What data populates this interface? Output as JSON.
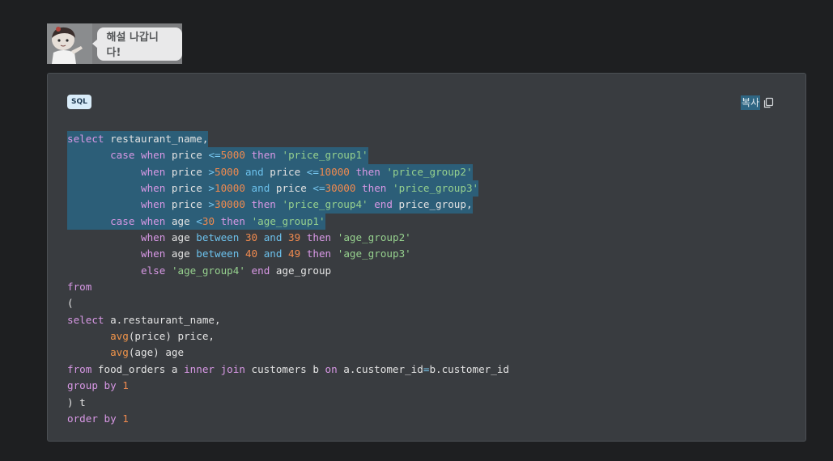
{
  "banner": {
    "bubble_text": "해설 나갑니다!"
  },
  "code_block": {
    "language": "SQL",
    "copy_label": "복사",
    "lines": [
      {
        "hl": true,
        "tokens": [
          [
            "k",
            "select"
          ],
          [
            "p",
            " restaurant_name,"
          ]
        ]
      },
      {
        "hl": true,
        "tokens": [
          [
            "p",
            "       "
          ],
          [
            "k",
            "case"
          ],
          [
            "p",
            " "
          ],
          [
            "k",
            "when"
          ],
          [
            "p",
            " price "
          ],
          [
            "o",
            "<="
          ],
          [
            "n",
            "5000"
          ],
          [
            "p",
            " "
          ],
          [
            "k",
            "then"
          ],
          [
            "p",
            " "
          ],
          [
            "s",
            "'price_group1'"
          ]
        ]
      },
      {
        "hl": true,
        "tokens": [
          [
            "p",
            "            "
          ],
          [
            "k",
            "when"
          ],
          [
            "p",
            " price "
          ],
          [
            "o",
            ">"
          ],
          [
            "n",
            "5000"
          ],
          [
            "p",
            " "
          ],
          [
            "kb",
            "and"
          ],
          [
            "p",
            " price "
          ],
          [
            "o",
            "<="
          ],
          [
            "n",
            "10000"
          ],
          [
            "p",
            " "
          ],
          [
            "k",
            "then"
          ],
          [
            "p",
            " "
          ],
          [
            "s",
            "'price_group2'"
          ]
        ]
      },
      {
        "hl": true,
        "tokens": [
          [
            "p",
            "            "
          ],
          [
            "k",
            "when"
          ],
          [
            "p",
            " price "
          ],
          [
            "o",
            ">"
          ],
          [
            "n",
            "10000"
          ],
          [
            "p",
            " "
          ],
          [
            "kb",
            "and"
          ],
          [
            "p",
            " price "
          ],
          [
            "o",
            "<="
          ],
          [
            "n",
            "30000"
          ],
          [
            "p",
            " "
          ],
          [
            "k",
            "then"
          ],
          [
            "p",
            " "
          ],
          [
            "s",
            "'price_group3'"
          ]
        ]
      },
      {
        "hl": true,
        "tokens": [
          [
            "p",
            "            "
          ],
          [
            "k",
            "when"
          ],
          [
            "p",
            " price "
          ],
          [
            "o",
            ">"
          ],
          [
            "n",
            "30000"
          ],
          [
            "p",
            " "
          ],
          [
            "k",
            "then"
          ],
          [
            "p",
            " "
          ],
          [
            "s",
            "'price_group4'"
          ],
          [
            "p",
            " "
          ],
          [
            "k",
            "end"
          ],
          [
            "p",
            " price_group,"
          ]
        ]
      },
      {
        "hl": true,
        "tokens": [
          [
            "p",
            "       "
          ],
          [
            "k",
            "case"
          ],
          [
            "p",
            " "
          ],
          [
            "k",
            "when"
          ],
          [
            "p",
            " age "
          ],
          [
            "o",
            "<"
          ],
          [
            "n",
            "30"
          ],
          [
            "p",
            " "
          ],
          [
            "k",
            "then"
          ],
          [
            "p",
            " "
          ],
          [
            "s",
            "'age_group1'"
          ]
        ]
      },
      {
        "hl": false,
        "tokens": [
          [
            "p",
            "            "
          ],
          [
            "k",
            "when"
          ],
          [
            "p",
            " age "
          ],
          [
            "kb",
            "between"
          ],
          [
            "p",
            " "
          ],
          [
            "n",
            "30"
          ],
          [
            "p",
            " "
          ],
          [
            "kb",
            "and"
          ],
          [
            "p",
            " "
          ],
          [
            "n",
            "39"
          ],
          [
            "p",
            " "
          ],
          [
            "k",
            "then"
          ],
          [
            "p",
            " "
          ],
          [
            "s",
            "'age_group2'"
          ]
        ]
      },
      {
        "hl": false,
        "tokens": [
          [
            "p",
            "            "
          ],
          [
            "k",
            "when"
          ],
          [
            "p",
            " age "
          ],
          [
            "kb",
            "between"
          ],
          [
            "p",
            " "
          ],
          [
            "n",
            "40"
          ],
          [
            "p",
            " "
          ],
          [
            "kb",
            "and"
          ],
          [
            "p",
            " "
          ],
          [
            "n",
            "49"
          ],
          [
            "p",
            " "
          ],
          [
            "k",
            "then"
          ],
          [
            "p",
            " "
          ],
          [
            "s",
            "'age_group3'"
          ]
        ]
      },
      {
        "hl": false,
        "tokens": [
          [
            "p",
            "            "
          ],
          [
            "k",
            "else"
          ],
          [
            "p",
            " "
          ],
          [
            "s",
            "'age_group4'"
          ],
          [
            "p",
            " "
          ],
          [
            "k",
            "end"
          ],
          [
            "p",
            " age_group"
          ]
        ]
      },
      {
        "hl": false,
        "tokens": [
          [
            "k",
            "from"
          ]
        ]
      },
      {
        "hl": false,
        "tokens": [
          [
            "p",
            "("
          ]
        ]
      },
      {
        "hl": false,
        "tokens": [
          [
            "k",
            "select"
          ],
          [
            "p",
            " a.restaurant_name,"
          ]
        ]
      },
      {
        "hl": false,
        "tokens": [
          [
            "p",
            "       "
          ],
          [
            "f",
            "avg"
          ],
          [
            "p",
            "(price) price,"
          ]
        ]
      },
      {
        "hl": false,
        "tokens": [
          [
            "p",
            "       "
          ],
          [
            "f",
            "avg"
          ],
          [
            "p",
            "(age) age"
          ]
        ]
      },
      {
        "hl": false,
        "tokens": [
          [
            "k",
            "from"
          ],
          [
            "p",
            " food_orders a "
          ],
          [
            "k",
            "inner"
          ],
          [
            "p",
            " "
          ],
          [
            "k",
            "join"
          ],
          [
            "p",
            " customers b "
          ],
          [
            "k",
            "on"
          ],
          [
            "p",
            " a.customer_id"
          ],
          [
            "o",
            "="
          ],
          [
            "p",
            "b.customer_id"
          ]
        ]
      },
      {
        "hl": false,
        "tokens": [
          [
            "k",
            "group"
          ],
          [
            "p",
            " "
          ],
          [
            "k",
            "by"
          ],
          [
            "p",
            " "
          ],
          [
            "n",
            "1"
          ]
        ]
      },
      {
        "hl": false,
        "tokens": [
          [
            "p",
            ") t"
          ]
        ]
      },
      {
        "hl": false,
        "tokens": [
          [
            "k",
            "order"
          ],
          [
            "p",
            " "
          ],
          [
            "k",
            "by"
          ],
          [
            "p",
            " "
          ],
          [
            "n",
            "1"
          ]
        ]
      }
    ]
  },
  "icons": {
    "avatar": "cartoon-avatar",
    "copy": "copy-icon"
  }
}
